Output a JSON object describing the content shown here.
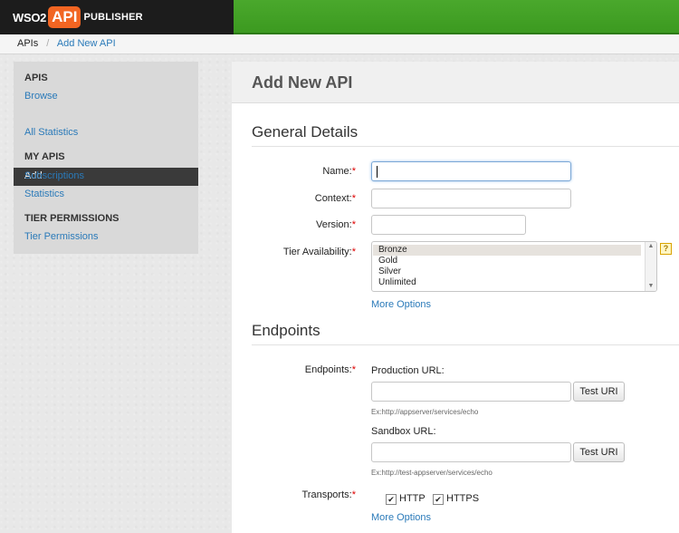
{
  "header": {
    "logo_wso2": "WSO2",
    "logo_api": "API",
    "logo_publisher": "PUBLISHER"
  },
  "breadcrumb": {
    "root": "APIs",
    "separator": "/",
    "current": "Add New API"
  },
  "sidebar": {
    "apis_heading": "APIS",
    "browse": "Browse",
    "add": "Add",
    "all_statistics": "All Statistics",
    "my_apis_heading": "MY APIS",
    "subscriptions": "Subscriptions",
    "statistics": "Statistics",
    "tier_heading": "TIER PERMISSIONS",
    "tier_permissions": "Tier Permissions"
  },
  "main": {
    "title": "Add New API",
    "general": {
      "title": "General Details",
      "name_label": "Name:",
      "name_value": "",
      "context_label": "Context:",
      "context_value": "",
      "version_label": "Version:",
      "version_value": "",
      "tier_label": "Tier Availability:",
      "tiers": [
        "Bronze",
        "Gold",
        "Silver",
        "Unlimited"
      ],
      "selected_tier": "Bronze",
      "help": "?",
      "more_options": "More Options"
    },
    "endpoints": {
      "title": "Endpoints",
      "endpoints_label": "Endpoints:",
      "production_label": "Production URL:",
      "production_value": "",
      "production_hint": "Ex:http://appserver/services/echo",
      "sandbox_label": "Sandbox URL:",
      "sandbox_value": "",
      "sandbox_hint": "Ex:http://test-appserver/services/echo",
      "test_uri": "Test URI",
      "transports_label": "Transports:",
      "http": "HTTP",
      "https": "HTTPS",
      "more_options": "More Options"
    },
    "required_mark": "*"
  }
}
